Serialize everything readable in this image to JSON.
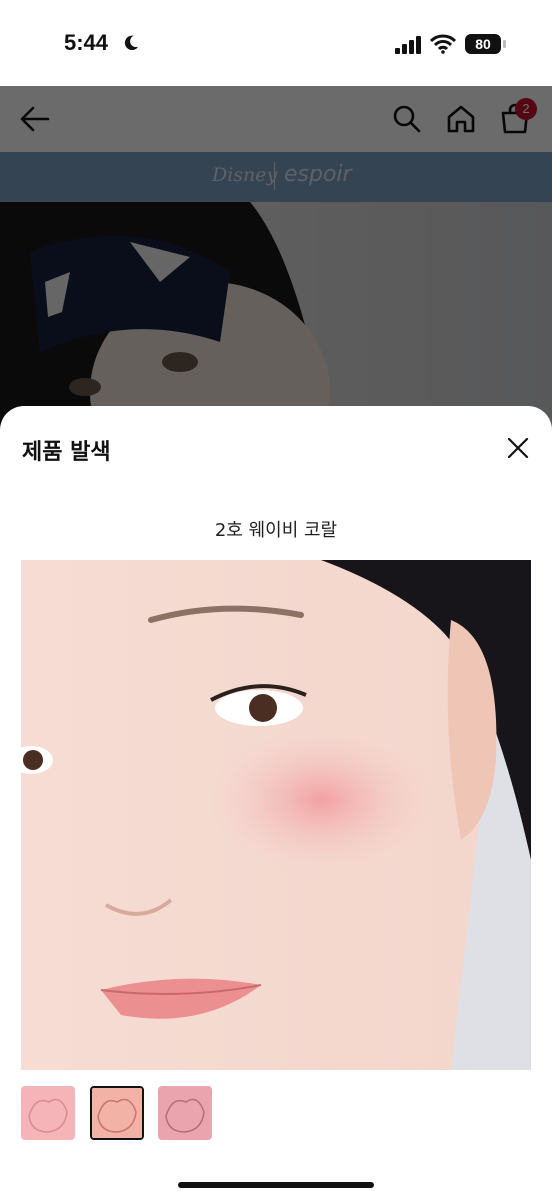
{
  "status_bar": {
    "time": "5:44",
    "battery": "80"
  },
  "app_bar": {
    "cart_count": "2"
  },
  "brand_banner": {
    "left_logo": "Disney",
    "right_logo": "espoir"
  },
  "sheet": {
    "title": "제품 발색",
    "shade_name": "2호 웨이비 코랄",
    "selected_thumbnail_index": 1,
    "thumbnail_count": 3
  },
  "icons": [
    "moon-icon",
    "signal-icon",
    "wifi-icon",
    "back-arrow-icon",
    "search-icon",
    "home-icon",
    "cart-icon",
    "close-icon"
  ],
  "colors": {
    "badge": "#c8102e",
    "brand_bar": "#7fa2c7",
    "blush": "#f2a3a6"
  }
}
